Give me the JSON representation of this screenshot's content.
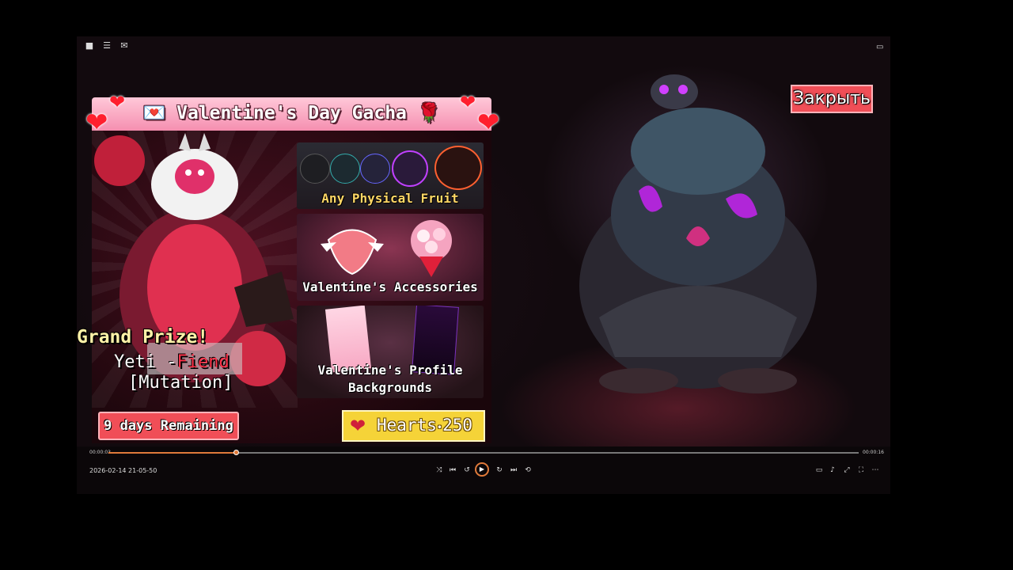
{
  "window": {
    "topbar_icons": [
      "roblox-logo-icon",
      "menu-icon",
      "chat-icon"
    ],
    "topbar_right_icon": "screenshot-icon"
  },
  "close_button": {
    "label": "Закрыть"
  },
  "gacha": {
    "title": "Valentine's Day Gacha",
    "grand_prize_label": "Grand Prize!",
    "prize_name": "Yeti -",
    "prize_name_accent": "Fiend",
    "prize_tag": "[Mutation]",
    "panels": [
      {
        "label": "Any Physical Fruit"
      },
      {
        "label": "Valentine's Accessories"
      },
      {
        "label": "Valentine's Profile Backgrounds"
      }
    ],
    "days_remaining": "9 days Remaining",
    "hearts_label": "Hearts",
    "hearts_value": "250",
    "colors": {
      "accent": "#f04e57",
      "gold": "#f5d338",
      "pink": "#f58fb0"
    }
  },
  "player": {
    "time_elapsed": "00:00:03",
    "time_total": "00:00:16",
    "progress": 0.17,
    "datestamp": "2026-02-14 21-05-50",
    "controls": [
      "shuffle-icon",
      "previous-icon",
      "rewind-icon",
      "play-icon",
      "forward-icon",
      "next-icon",
      "loop-icon"
    ],
    "right_controls": [
      "miniplayer-icon",
      "volume-icon",
      "expand-icon",
      "fullscreen-icon",
      "more-icon"
    ]
  }
}
